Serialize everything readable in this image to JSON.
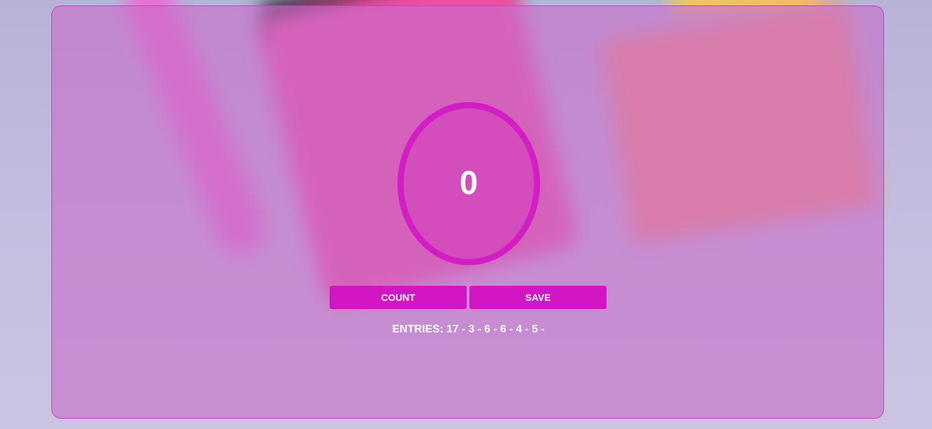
{
  "counter": {
    "value": "0"
  },
  "buttons": {
    "count_label": "COUNT",
    "save_label": "SAVE"
  },
  "entries": {
    "label": "ENTRIES:",
    "values_text": "17 - 3 - 6 - 6 - 4 - 5 -",
    "values": [
      17,
      3,
      6,
      6,
      4,
      5
    ]
  },
  "colors": {
    "accent": "#d216c4",
    "card": "#c66ec8",
    "text": "#ffffff"
  }
}
